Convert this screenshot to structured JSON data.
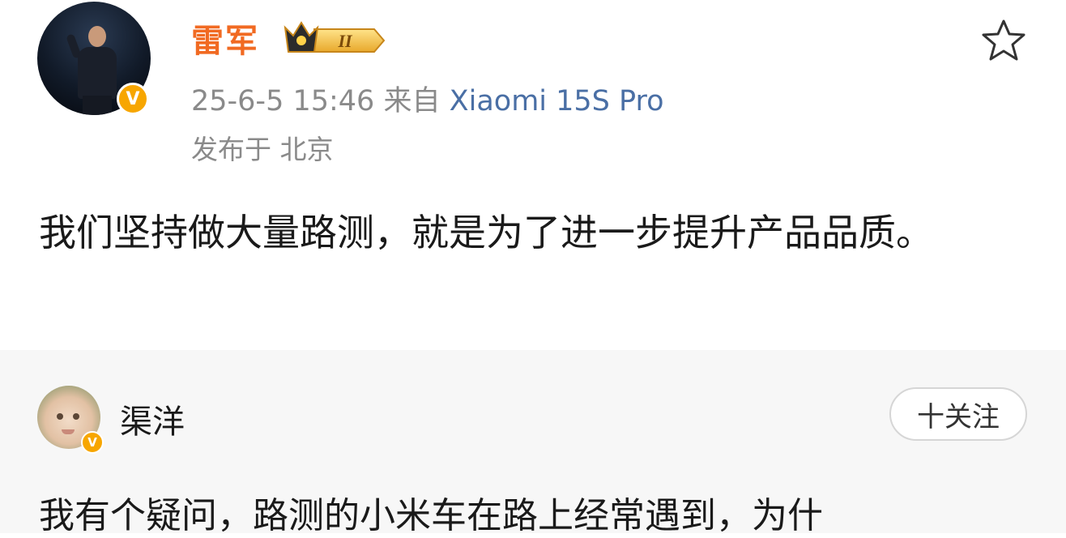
{
  "post": {
    "author": "雷军",
    "level_badge": "II",
    "timestamp": "25-6-5 15:46",
    "source_prefix": "来自",
    "source_device": "Xiaomi 15S Pro",
    "location": "发布于 北京",
    "content": "我们坚持做大量路测，就是为了进一步提升产品品质。",
    "verified_mark": "V"
  },
  "comment": {
    "author": "渠洋",
    "follow_label": "十关注",
    "text": "我有个疑问，路测的小米车在路上经常遇到，为什",
    "verified_mark": "V"
  },
  "colors": {
    "author_name": "#f16a22",
    "source_link": "#4a6fa5",
    "verified_badge": "#f7a600",
    "meta_text": "#8a8a8a"
  },
  "icons": [
    "avatar",
    "verified-badge",
    "crown-level-badge",
    "star-icon"
  ]
}
